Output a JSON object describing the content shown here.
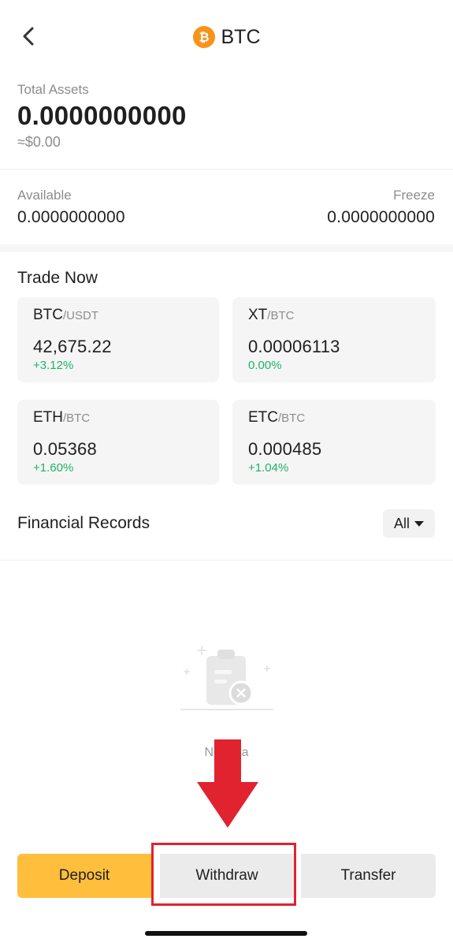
{
  "header": {
    "title": "BTC",
    "coin_icon": "bitcoin-icon",
    "back_icon": "chevron-left-icon"
  },
  "balance": {
    "total_label": "Total Assets",
    "total_value": "0.0000000000",
    "approx_value": "≈$0.00",
    "available_label": "Available",
    "available_value": "0.0000000000",
    "freeze_label": "Freeze",
    "freeze_value": "0.0000000000"
  },
  "trade_now": {
    "title": "Trade Now",
    "pairs": [
      {
        "base": "BTC",
        "quote": "/USDT",
        "price": "42,675.22",
        "change": "+3.12%"
      },
      {
        "base": "XT",
        "quote": "/BTC",
        "price": "0.00006113",
        "change": "0.00%"
      },
      {
        "base": "ETH",
        "quote": "/BTC",
        "price": "0.05368",
        "change": "+1.60%"
      },
      {
        "base": "ETC",
        "quote": "/BTC",
        "price": "0.000485",
        "change": "+1.04%"
      }
    ]
  },
  "records": {
    "title": "Financial Records",
    "filter_label": "All",
    "empty_text": "No data"
  },
  "actions": {
    "deposit": "Deposit",
    "withdraw": "Withdraw",
    "transfer": "Transfer"
  },
  "colors": {
    "accent": "#ffbe3c",
    "positive": "#20b26c",
    "highlight": "#e0232f",
    "coin": "#f7931a"
  }
}
